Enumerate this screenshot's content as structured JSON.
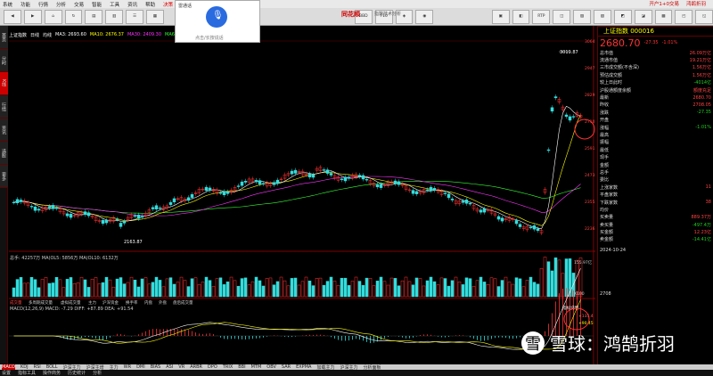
{
  "menu": {
    "items": [
      "系统",
      "功能",
      "行情",
      "分析",
      "交易",
      "智能",
      "工具",
      "资讯",
      "帮助",
      "决策"
    ],
    "right": [
      "开户1+0交易",
      "鸿鹄折羽"
    ]
  },
  "toolbar": {
    "logo": "同花顺",
    "subtitle": "指数技术分析",
    "buttons": [
      "BBD",
      "F10",
      "RTP"
    ]
  },
  "voice": {
    "title": "雷通话",
    "hint": "点击/长按说话"
  },
  "chart": {
    "title": "上证指数",
    "timeframe": "日线",
    "ma": {
      "label": "均线",
      "ma3": "MA3: 2693.60",
      "ma10": "MA10: 2676.37",
      "ma30": "MA30: 2409.30",
      "ma60": "MA60: 2325.46"
    },
    "high_label": "3019.87",
    "low_label": "2163.87",
    "yticks": [
      "3064",
      "2947",
      "2829",
      "2710",
      "2591",
      "2473",
      "2355",
      "2236"
    ],
    "vol_label": "总手: 42257万  MA(OL5: 5856万  MA(OL10: 6132万",
    "vol_ticks": [
      "155.97亿",
      "X100"
    ],
    "macd_label": "MACD(12,26,9) MACD: -7.29  DIFF: +87.89  DEA: +91.54",
    "macd_annot": [
      "指标说明",
      "+135.4",
      "+90.45"
    ],
    "sub_tabs": [
      "成交量",
      "多周期成交量",
      "虚拟成交量",
      "主力",
      "沪深资金",
      "换手率",
      "内盘",
      "外盘",
      "盘后成交量"
    ]
  },
  "right": {
    "title": "上证指数 000016",
    "price": "2680.70",
    "chg": "-27.35",
    "pct": "-1.01%",
    "rows": [
      [
        "总市值",
        "26.09万亿"
      ],
      [
        "流通市值",
        "19.21万亿"
      ],
      [
        "三市成交额(不含深)",
        "1.56万亿"
      ],
      [
        "预估成交额",
        "1.56万亿"
      ],
      [
        "较上日此时",
        "-4014亿"
      ],
      [
        "沪股通额度余额",
        "额度充足"
      ],
      [
        "最新",
        "2680.70"
      ],
      [
        "昨收",
        "2708.05"
      ],
      [
        "涨跌",
        "-27.35"
      ],
      [
        "开盘",
        ""
      ],
      [
        "涨幅",
        "-1.01%"
      ],
      [
        "最高",
        ""
      ],
      [
        "振幅",
        ""
      ],
      [
        "最低",
        ""
      ],
      [
        "现手",
        ""
      ],
      [
        "金额",
        ""
      ],
      [
        "总手",
        ""
      ],
      [
        "委比",
        ""
      ],
      [
        "上涨家数",
        "11"
      ],
      [
        "平盘家数",
        ""
      ],
      [
        "下跌家数",
        "38"
      ],
      [
        "均价",
        ""
      ],
      [
        "买卖量",
        "889.37万"
      ],
      [
        "卖买量",
        "-497.4万"
      ],
      [
        "买金额",
        "12.23亿"
      ],
      [
        "卖金额",
        "-14.41亿"
      ]
    ],
    "date": "2024-10-24",
    "vol_value": "2708"
  },
  "bottom": {
    "indicators": [
      "MACD",
      "KDJ",
      "RSI",
      "BOLL",
      "沪深主力",
      "沪深主增",
      "主力",
      "WR",
      "DMI",
      "BIAS",
      "ASI",
      "VR",
      "ARBR",
      "DPO",
      "TRIX",
      "BBI",
      "MTM",
      "OBV",
      "SAR",
      "EXPMA",
      "加载主力",
      "沪深主力",
      "分析面板"
    ],
    "tabs": [
      "设置",
      "指标工具",
      "操作商务",
      "历史统计",
      "分析"
    ]
  },
  "watermark": {
    "logo": "雪",
    "text": "雪球：鸿鹄折羽"
  },
  "colors": {
    "up": "#ff3333",
    "down": "#33dddd",
    "ma5": "#ffffff",
    "ma10": "#ffff00",
    "ma30": "#ff33ff",
    "ma60": "#33ff33"
  }
}
